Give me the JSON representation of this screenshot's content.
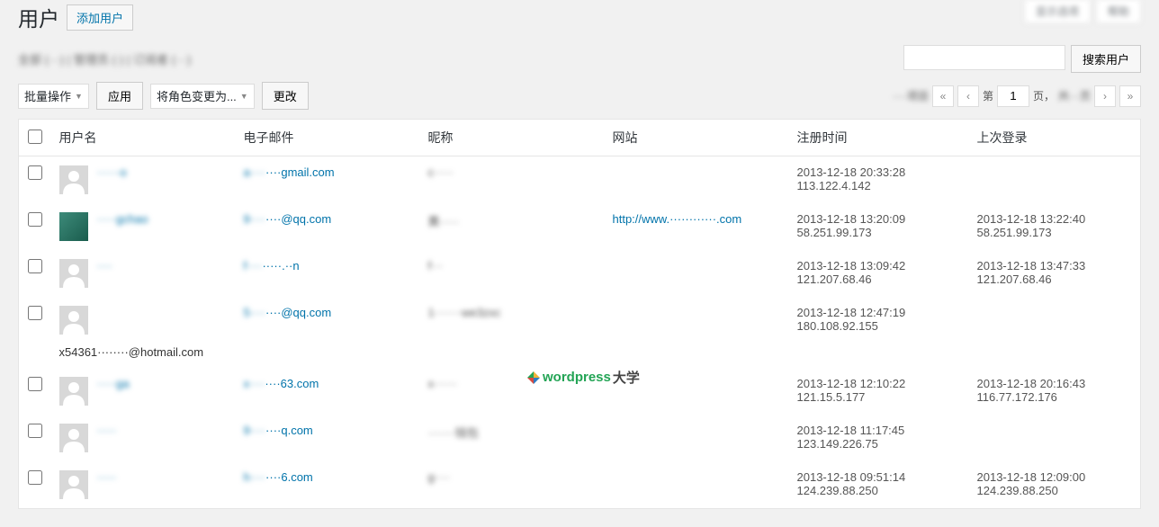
{
  "header": {
    "title": "用户",
    "add_button": "添加用户",
    "screen_options": "显示选项",
    "help": "帮助"
  },
  "filters": {
    "all_text": "全部 (···) | 管理员 (·) | 订阅者 (···)"
  },
  "search": {
    "placeholder": "",
    "button": "搜索用户"
  },
  "tablenav": {
    "bulk_action": "批量操作",
    "apply": "应用",
    "change_role": "将角色变更为...",
    "change": "更改",
    "items_text": "····项目",
    "page_label_before": "第",
    "page_value": "1",
    "page_label_after": "页，",
    "total_pages": "共···页"
  },
  "table": {
    "headers": {
      "username": "用户名",
      "email": "电子邮件",
      "nickname": "昵称",
      "website": "网站",
      "reg_time": "注册时间",
      "last_login": "上次登录"
    },
    "rows": [
      {
        "username": "······o",
        "email": "a········gmail.com",
        "nickname": "c·····",
        "website": "",
        "reg_time": "2013-12-18 20:33:28",
        "reg_ip": "113.122.4.142",
        "login_time": "",
        "login_ip": ""
      },
      {
        "username": "·····gchao",
        "email": "9········@qq.com",
        "nickname": "黄·····",
        "website": "http://www.············.com",
        "reg_time": "2013-12-18 13:20:09",
        "reg_ip": "58.251.99.173",
        "login_time": "2013-12-18 13:22:40",
        "login_ip": "58.251.99.173"
      },
      {
        "username": "····",
        "email": "f·········.··n",
        "nickname": "f···",
        "website": "",
        "reg_time": "2013-12-18 13:09:42",
        "reg_ip": "121.207.68.46",
        "login_time": "2013-12-18 13:47:33",
        "login_ip": "121.207.68.46"
      },
      {
        "username": "",
        "below": "x54361········@hotmail.com",
        "email": "5········@qq.com",
        "nickname": "1·······we3zxc",
        "website": "",
        "reg_time": "2013-12-18 12:47:19",
        "reg_ip": "180.108.92.155",
        "login_time": "",
        "login_ip": ""
      },
      {
        "username": "·····ga",
        "email": "x········63.com",
        "nickname": "x······",
        "website": "",
        "reg_time": "2013-12-18 12:10:22",
        "reg_ip": "121.15.5.177",
        "login_time": "2013-12-18 20:16:43",
        "login_ip": "116.77.172.176"
      },
      {
        "username": "·····",
        "email": "9········q.com",
        "nickname": "·······钱包",
        "website": "",
        "reg_time": "2013-12-18 11:17:45",
        "reg_ip": "123.149.226.75",
        "login_time": "",
        "login_ip": ""
      },
      {
        "username": "·····",
        "email": "h········6.com",
        "nickname": "g····",
        "website": "",
        "reg_time": "2013-12-18 09:51:14",
        "reg_ip": "124.239.88.250",
        "login_time": "2013-12-18 12:09:00",
        "login_ip": "124.239.88.250"
      }
    ]
  },
  "watermark": {
    "text1": "wordpress",
    "text2": "大学"
  }
}
